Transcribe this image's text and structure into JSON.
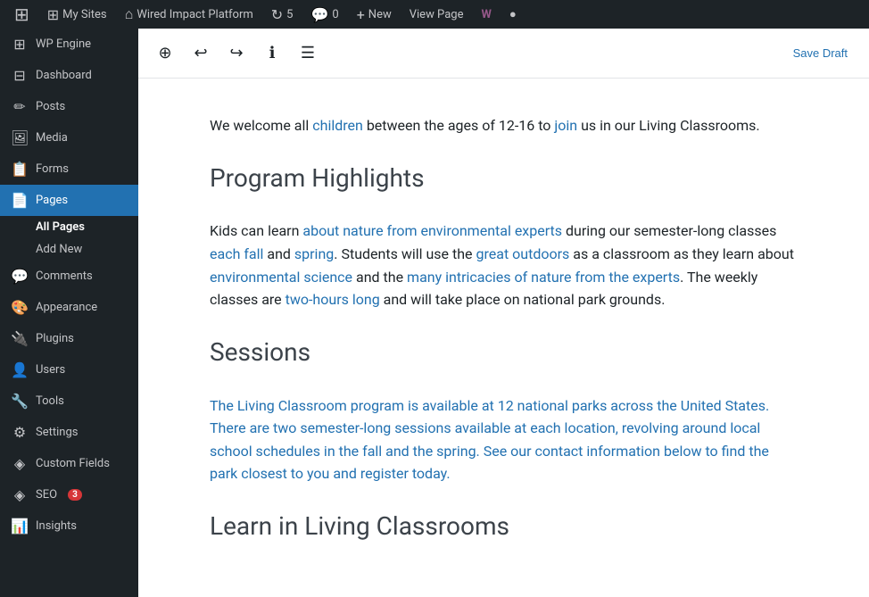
{
  "adminBar": {
    "wpLogoLabel": "WordPress",
    "mySitesLabel": "My Sites",
    "siteLabel": "Wired Impact Platform",
    "updatesCount": "5",
    "commentsCount": "0",
    "newLabel": "New",
    "viewPageLabel": "View Page",
    "icons": {
      "mySites": "⊞",
      "site": "⌂",
      "updates": "↻",
      "comments": "💬",
      "new": "+",
      "wooIcon": "W",
      "circle": "●"
    }
  },
  "sidebar": {
    "items": [
      {
        "id": "wp-engine",
        "label": "WP Engine",
        "icon": "⊞"
      },
      {
        "id": "dashboard",
        "label": "Dashboard",
        "icon": "⊟"
      },
      {
        "id": "posts",
        "label": "Posts",
        "icon": "📝"
      },
      {
        "id": "media",
        "label": "Media",
        "icon": "🖼"
      },
      {
        "id": "forms",
        "label": "Forms",
        "icon": "📋"
      },
      {
        "id": "pages",
        "label": "Pages",
        "icon": "📄",
        "active": true
      },
      {
        "id": "comments",
        "label": "Comments",
        "icon": "💬"
      },
      {
        "id": "appearance",
        "label": "Appearance",
        "icon": "🎨"
      },
      {
        "id": "plugins",
        "label": "Plugins",
        "icon": "🔌"
      },
      {
        "id": "users",
        "label": "Users",
        "icon": "👤"
      },
      {
        "id": "tools",
        "label": "Tools",
        "icon": "🔧"
      },
      {
        "id": "settings",
        "label": "Settings",
        "icon": "⚙"
      },
      {
        "id": "custom-fields",
        "label": "Custom Fields",
        "icon": "📦"
      },
      {
        "id": "seo",
        "label": "SEO",
        "icon": "◈",
        "badge": "3"
      },
      {
        "id": "insights",
        "label": "Insights",
        "icon": "📊"
      }
    ],
    "subItems": {
      "pages": [
        {
          "id": "all-pages",
          "label": "All Pages",
          "active": true
        },
        {
          "id": "add-new",
          "label": "Add New"
        }
      ]
    }
  },
  "editor": {
    "toolbar": {
      "addBlockLabel": "Add block",
      "undoLabel": "Undo",
      "redoLabel": "Redo",
      "infoLabel": "Details",
      "listViewLabel": "List view",
      "saveDraftLabel": "Save Draft"
    },
    "content": {
      "paragraph1": "We welcome all children between the ages of 12-16 to join us in our Living Classrooms.",
      "heading1": "Program Highlights",
      "paragraph2": "Kids can learn about nature from environmental experts during our semester-long classes each fall and spring. Students will use the great outdoors as a classroom as they learn about environmental science and the many intricacies of nature from the experts. The weekly classes are two-hours long and will take place on national park grounds.",
      "heading2": "Sessions",
      "paragraph3": "The Living Classroom program is available at 12 national parks across the United States. There are two semester-long sessions available at each location, revolving around local school schedules in the fall and the spring. See our contact information below to find the park closest to you and register today.",
      "heading3": "Learn in Living Classrooms",
      "linkWords1": [
        "children",
        "join"
      ],
      "linkPhrases2": [
        "about nature from environmental experts",
        "each fall",
        "spring",
        "great outdoors",
        "environmental science",
        "many intricacies of nature from the experts",
        "two-hours long"
      ]
    }
  }
}
